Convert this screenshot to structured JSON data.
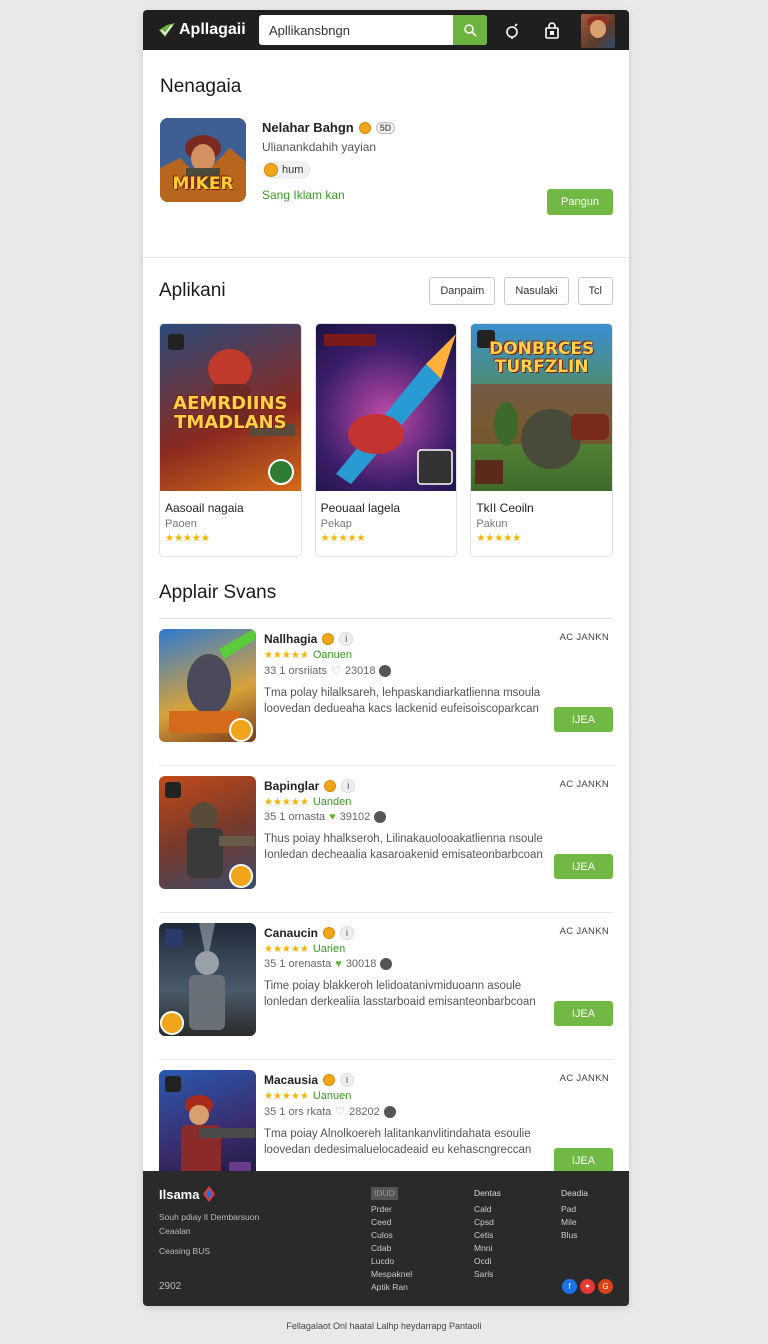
{
  "header": {
    "logo": "Apllagaii",
    "search_value": "Apllikansbngn"
  },
  "featured": {
    "title": "Nenagaia",
    "name": "Nelahar Bahgn",
    "badge": "5D",
    "subtitle": "Ulianankdahih yayian",
    "pill": "hum",
    "link": "Sang Iklam kan",
    "button": "Pangun",
    "thumb_text": "MIKER"
  },
  "apps": {
    "title": "Aplikani",
    "filters": [
      "Danpaim",
      "Nasulaki",
      "Tcl"
    ],
    "cards": [
      {
        "art": "AEMRDIINS\nTMADLANS",
        "title": "Aasoail nagaia",
        "sub": "Paoen",
        "stars": "★★★★★"
      },
      {
        "art": "",
        "title": "Peouaal lagela",
        "sub": "Pekap",
        "stars": "★★★★★"
      },
      {
        "art": "DONBRCES\nTURFZLIN",
        "title": "TkII Ceoiln",
        "sub": "Pakun",
        "stars": "★★★★★"
      }
    ]
  },
  "list": {
    "title": "Applair Svans",
    "items": [
      {
        "name": "Nallhagia",
        "rating": "Oanuen",
        "meta1": "33 1 orsriiats",
        "meta2": "23018",
        "desc": "Tma polay hilalksareh, lehpaskandiarkatlienna msoula loovedan dedueaha kacs lackenid eufeisoiscoparkcan",
        "tag": "AC JANKN",
        "button": "IJEA"
      },
      {
        "name": "Bapinglar",
        "rating": "Uanden",
        "meta1": "35 1 ornasta",
        "meta2": "39102",
        "desc": "Thus poiay hhalkseroh, Lilinakauolooakatlienna nsoule Ionledan decheaalia kasaroakenid emisateonbarbcoan",
        "tag": "AC JANKN",
        "button": "IJEA"
      },
      {
        "name": "Canaucin",
        "rating": "Uarien",
        "meta1": "35 1 orenasta",
        "meta2": "30018",
        "desc": "Time poiay blakkeroh lelidoatanivmiduoann asoule lonledan derkealiia lasstarboaid emisanteonbarbcoan",
        "tag": "AC JANKN",
        "button": "IJEA"
      },
      {
        "name": "Macausia",
        "rating": "Uanuen",
        "meta1": "35 1 ors rkata",
        "meta2": "28202",
        "desc": "Tma poiay Alnolkoereh lalitankanvlitindahata esoulie loovedan dedesimaluelocadeaid eu kehascngreccan",
        "tag": "AC JANKN",
        "button": "IJEA"
      }
    ]
  },
  "footer": {
    "brand": "Ilsama",
    "line1": "Souh pdiay lI Dembarsuon",
    "line2": "Ceaalan",
    "line3": "Ceasing BUS",
    "year": "2902",
    "col1_head": "IDUD",
    "col1": [
      "Prder",
      "Ceed",
      "Culos",
      "Cdab",
      "Lucdo",
      "Mespaknel",
      "Aptik Ran"
    ],
    "col2_head": "Dentas",
    "col2": [
      "Cald",
      "Cpsd",
      "Cetis",
      "Mnni",
      "Ocdi",
      "Sarls"
    ],
    "col3_head": "Deadia",
    "col3": [
      "Pad",
      "Mile",
      "Blus"
    ],
    "social": [
      "f",
      "✦",
      "G"
    ],
    "social_colors": [
      "#1a73e8",
      "#e53935",
      "#d84315"
    ],
    "note": "Fellagalaot Onl haatal Lalhp heydarrapg Pantaoli"
  },
  "colors": {
    "accent_green": "#72b845",
    "header_bg": "#1f1f1f",
    "footer_bg": "#2a2a2a",
    "star": "#f4b400"
  }
}
